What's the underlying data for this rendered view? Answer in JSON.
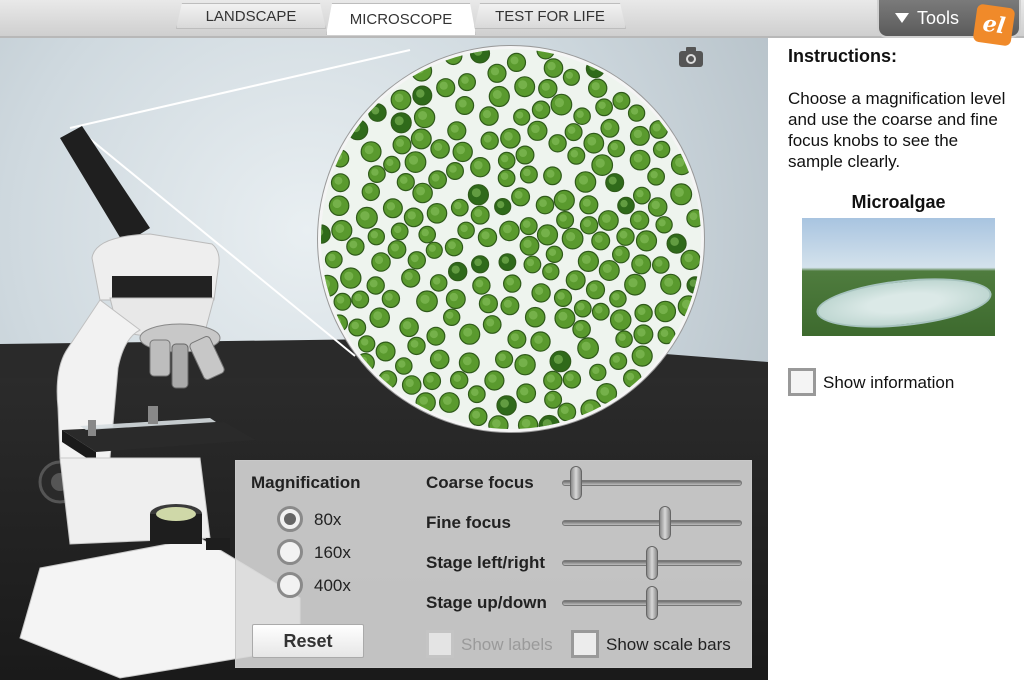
{
  "tabs": [
    {
      "label": "LANDSCAPE",
      "active": false
    },
    {
      "label": "MICROSCOPE",
      "active": true
    },
    {
      "label": "TEST FOR LIFE",
      "active": false
    }
  ],
  "tools": {
    "label": "Tools",
    "logo_text": "el"
  },
  "icons": {
    "camera": "camera-icon",
    "tools_dropdown": "triangle-down-icon",
    "logo": "explorelearning-logo"
  },
  "controls": {
    "magnification_title": "Magnification",
    "magnification_options": [
      "80x",
      "160x",
      "400x"
    ],
    "magnification_selected": "80x",
    "reset_label": "Reset",
    "sliders": [
      {
        "label": "Coarse focus",
        "value": 0.05
      },
      {
        "label": "Fine focus",
        "value": 0.58
      },
      {
        "label": "Stage left/right",
        "value": 0.5
      },
      {
        "label": "Stage up/down",
        "value": 0.5
      }
    ],
    "show_labels": {
      "label": "Show labels",
      "checked": false,
      "disabled": true
    },
    "show_scale_bars": {
      "label": "Show scale bars",
      "checked": false,
      "disabled": false
    }
  },
  "sidebar": {
    "title": "Instructions:",
    "text": "Choose a magnification level and use the coarse and fine focus knobs to see the sample clearly.",
    "sample_title": "Microalgae",
    "show_information": {
      "label": "Show information",
      "checked": false
    }
  },
  "colors": {
    "cell": "#5a9a2e",
    "cell_dark": "#2f6a1a",
    "logo": "#f08a2a"
  }
}
